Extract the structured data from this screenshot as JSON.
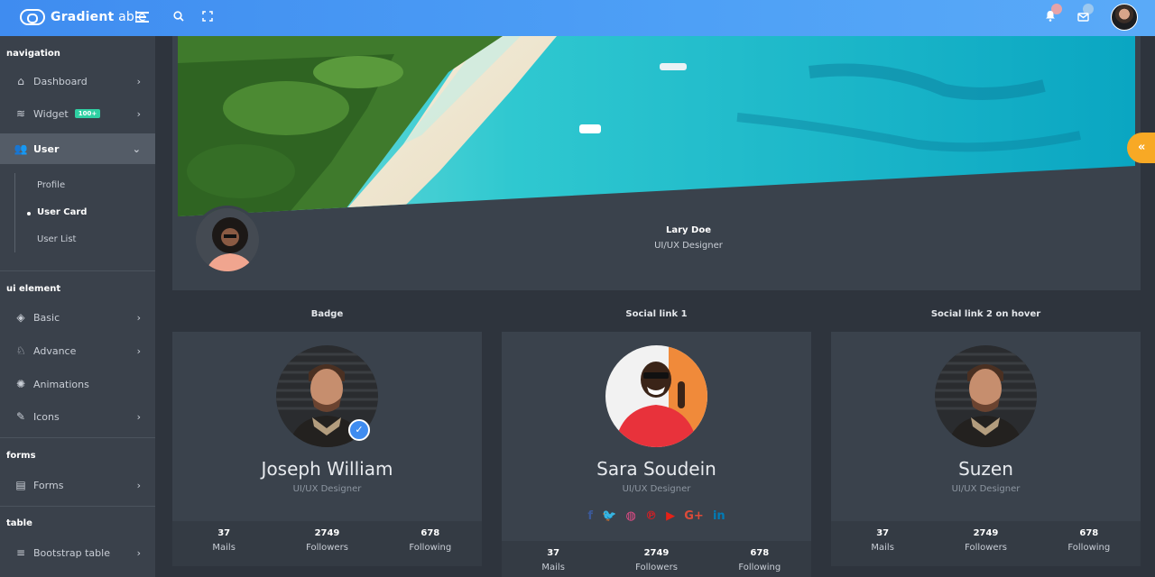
{
  "brand": {
    "name_bold": "Gradient",
    "name_light": " able"
  },
  "sidebar": {
    "sections": {
      "navigation": "navigation",
      "ui_element": "ui element",
      "forms": "forms",
      "table": "table"
    },
    "items": {
      "dashboard": "Dashboard",
      "widget": "Widget",
      "widget_badge": "100+",
      "user": "User",
      "basic": "Basic",
      "advance": "Advance",
      "animations": "Animations",
      "icons": "Icons",
      "forms": "Forms",
      "bootstrap_table": "Bootstrap table"
    },
    "user_sub": [
      "Profile",
      "User Card",
      "User List"
    ]
  },
  "hero": {
    "name": "Lary Doe",
    "role": "UI/UX Designer"
  },
  "columns": [
    "Badge",
    "Social link 1",
    "Social link 2 on hover"
  ],
  "cards": [
    {
      "name": "Joseph William",
      "role": "UI/UX Designer",
      "stats": [
        {
          "value": "37",
          "label": "Mails"
        },
        {
          "value": "2749",
          "label": "Followers"
        },
        {
          "value": "678",
          "label": "Following"
        }
      ]
    },
    {
      "name": "Sara Soudein",
      "role": "UI/UX Designer",
      "stats": [
        {
          "value": "37",
          "label": "Mails"
        },
        {
          "value": "2749",
          "label": "Followers"
        },
        {
          "value": "678",
          "label": "Following"
        }
      ]
    },
    {
      "name": "Suzen",
      "role": "UI/UX Designer",
      "stats": [
        {
          "value": "37",
          "label": "Mails"
        },
        {
          "value": "2749",
          "label": "Followers"
        },
        {
          "value": "678",
          "label": "Following"
        }
      ]
    }
  ],
  "social_icons": [
    "facebook-icon",
    "twitter-icon",
    "dribbble-icon",
    "pinterest-icon",
    "youtube-icon",
    "google-plus-icon",
    "linkedin-icon"
  ],
  "colors": {
    "topbar": "#4ea0f6",
    "accent_green": "#2fd0a3",
    "accent_orange": "#f8a925",
    "card_bg": "#3a424c"
  }
}
